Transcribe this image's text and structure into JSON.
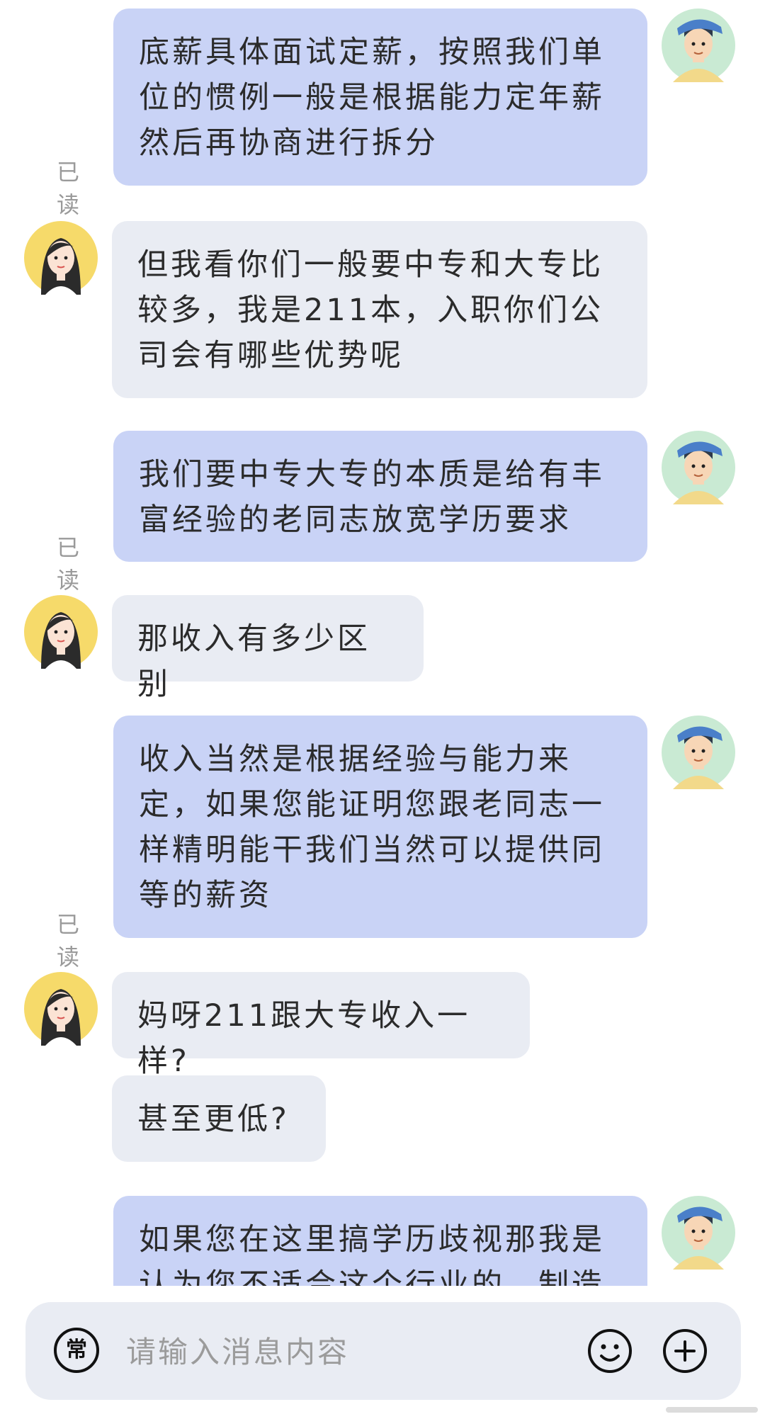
{
  "messages": [
    {
      "side": "sent",
      "text": "底薪具体面试定薪，按照我们单位的惯例一般是根据能力定年薪然后再协商进行拆分",
      "read_label": "已读"
    },
    {
      "side": "recv",
      "text": "但我看你们一般要中专和大专比较多，我是211本，入职你们公司会有哪些优势呢"
    },
    {
      "side": "sent",
      "text": "我们要中专大专的本质是给有丰富经验的老同志放宽学历要求",
      "read_label": "已读"
    },
    {
      "side": "recv",
      "text": "那收入有多少区别"
    },
    {
      "side": "sent",
      "text": "收入当然是根据经验与能力来定，如果您能证明您跟老同志一样精明能干我们当然可以提供同等的薪资",
      "read_label": "已读"
    },
    {
      "side": "recv",
      "text": "妈呀211跟大专收入一样?"
    },
    {
      "side": "recv",
      "text": "甚至更低?"
    },
    {
      "side": "sent",
      "text": "如果您在这里搞学历歧视那我是认为您不适合这个行业的，制造"
    }
  ],
  "input": {
    "mode_label": "常",
    "placeholder": "请输入消息内容",
    "emoji_icon": "smiley-icon",
    "add_icon": "plus-circle-icon"
  }
}
